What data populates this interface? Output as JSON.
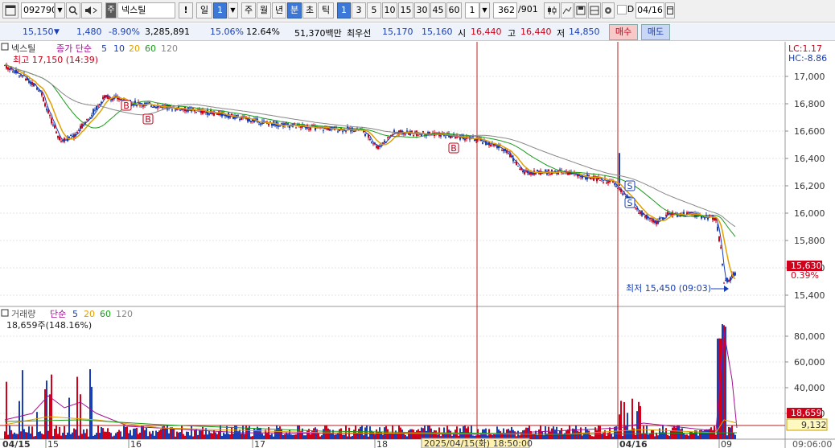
{
  "toolbar": {
    "code": "092790",
    "search_icon": "magnifier-icon",
    "sound_icon": "speaker-icon",
    "badge": "주",
    "stock_name": "넥스틸",
    "alert": "!",
    "period_day": "일",
    "period_day_num": "1",
    "week": "주",
    "month": "월",
    "year": "년",
    "minute": "분",
    "second": "초",
    "tick": "틱",
    "intervals": [
      "1",
      "3",
      "5",
      "10",
      "15",
      "30",
      "45",
      "60"
    ],
    "custom_interval": "1",
    "count": "362",
    "total": "/901",
    "date_checkbox": "D",
    "date": "04/16"
  },
  "info": {
    "price": "15,150",
    "change": "1,480",
    "change_pct": "-8.90%",
    "volume": "3,285,891",
    "rate1": "15.06%",
    "rate2": "12.64%",
    "amount": "51,370백만",
    "best_label": "최우선",
    "best_ask": "15,170",
    "best_bid": "15,160",
    "open_label": "시",
    "open": "16,440",
    "high_label": "고",
    "high": "16,440",
    "low_label": "저",
    "low": "14,850",
    "buy": "매수",
    "sell": "매도"
  },
  "price_panel": {
    "stock_label": "넥스틸",
    "ma_label": "종가 단순",
    "ma_periods": [
      "5",
      "10",
      "20",
      "60",
      "120"
    ],
    "ma_colors": [
      "#1a3fb4",
      "#1a3fb4",
      "#e0a000",
      "#1a9a1a",
      "#888888"
    ],
    "high_note": "최고 17,150 (14:39)",
    "low_note": "최저 15,450 (09:03)",
    "lc": "LC:1.17",
    "hc": "HC:-8.86",
    "price_tag": "15,630",
    "pct_tag": "0.39%",
    "y_ticks": [
      "17,000",
      "16,800",
      "16,600",
      "16,400",
      "16,200",
      "16,000",
      "15,800",
      "15,600",
      "15,400"
    ]
  },
  "volume_panel": {
    "label": "거래량",
    "ma_label": "단순",
    "ma_periods": [
      "5",
      "20",
      "60",
      "120"
    ],
    "value_note": "18,659주(148.16%)",
    "y_ticks": [
      "80,000",
      "60,000",
      "40,000",
      "20,000"
    ],
    "vol_tag": "18,659",
    "ma_tag": "9,132"
  },
  "x_axis": {
    "labels": [
      "04/15",
      "15",
      "16",
      "17",
      "18",
      "04/16",
      "09"
    ],
    "cursor_label": "2025/04/15(화) 18:50:00",
    "time_label": "09:06:00"
  },
  "signals": {
    "buy": "B",
    "sell": "S"
  },
  "colors": {
    "up": "#d0021b",
    "down": "#1a3fb4",
    "buy_color": "#c4001a",
    "sell_color": "#1a3fb4"
  }
}
